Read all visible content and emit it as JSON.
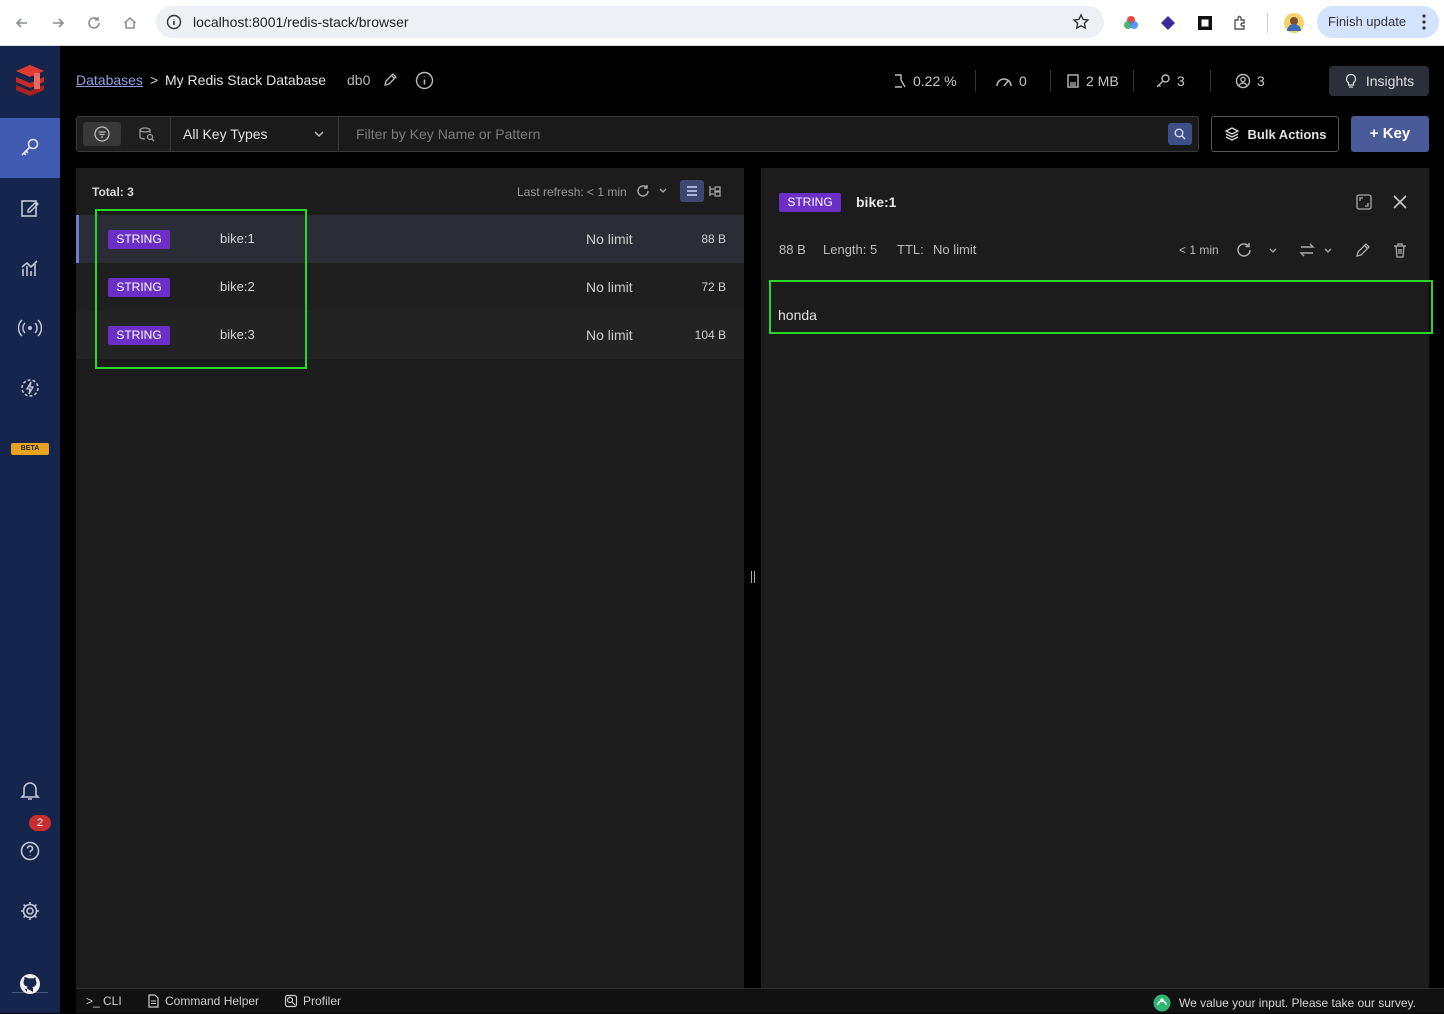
{
  "browser": {
    "url": "localhost:8001/redis-stack/browser",
    "update_label": "Finish update"
  },
  "sidebar": {
    "beta_label": "BETA",
    "notification_count": "2"
  },
  "header": {
    "breadcrumb_root": "Databases",
    "breadcrumb_sep": ">",
    "database_name": "My Redis Stack Database",
    "db_index": "db0",
    "stats": {
      "cpu": "0.22 %",
      "ops": "0",
      "memory": "2 MB",
      "keys": "3",
      "clients": "3"
    },
    "insights_label": "Insights"
  },
  "filter": {
    "key_type": "All Key Types",
    "search_placeholder": "Filter by Key Name or Pattern",
    "bulk_actions_label": "Bulk Actions",
    "add_key_label": "+ Key"
  },
  "list": {
    "total_label": "Total: 3",
    "last_refresh": "Last refresh: < 1 min",
    "rows": [
      {
        "type": "STRING",
        "name": "bike:1",
        "ttl": "No limit",
        "size": "88 B"
      },
      {
        "type": "STRING",
        "name": "bike:2",
        "ttl": "No limit",
        "size": "72 B"
      },
      {
        "type": "STRING",
        "name": "bike:3",
        "ttl": "No limit",
        "size": "104 B"
      }
    ]
  },
  "detail": {
    "type": "STRING",
    "key": "bike:1",
    "size": "88 B",
    "length": "Length: 5",
    "ttl_label": "TTL:",
    "ttl_value": "No limit",
    "refresh": "< 1 min",
    "value": "honda"
  },
  "bottombar": {
    "cli": ">_ CLI",
    "command_helper": "Command Helper",
    "profiler": "Profiler",
    "survey": "We value your input. Please take our survey."
  },
  "colors": {
    "sidebar": "#15254b",
    "string_badge": "#6b2fc8",
    "primary_button": "#4a5b9a",
    "highlight": "#28d828"
  }
}
